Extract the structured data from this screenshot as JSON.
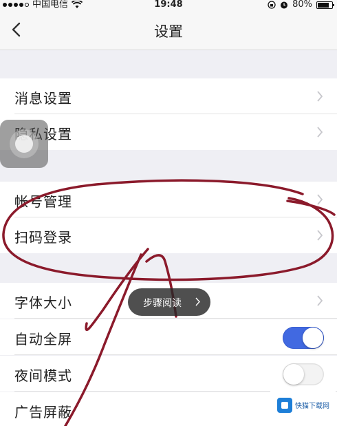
{
  "status_bar": {
    "carrier": "中国电信",
    "time": "19:48",
    "battery": "80%",
    "battery_level": 0.8
  },
  "nav": {
    "title": "设置",
    "back_icon": "chevron-left-icon"
  },
  "settings": {
    "group1": [
      {
        "label": "消息设置"
      },
      {
        "label": "隐私设置"
      }
    ],
    "group2": [
      {
        "label": "帐号管理"
      },
      {
        "label": "扫码登录"
      }
    ],
    "group3": [
      {
        "label": "字体大小"
      },
      {
        "label": "自动全屏",
        "toggle": "on"
      },
      {
        "label": "夜间模式",
        "toggle": "off"
      },
      {
        "label": "广告屏蔽"
      }
    ]
  },
  "toast": {
    "label": "步骤阅读"
  },
  "watermark": {
    "text": "快猫下载网"
  },
  "colors": {
    "toggle_on": "#4169e1",
    "annotation_stroke": "#8b1a2b",
    "background": "#efeff4"
  }
}
